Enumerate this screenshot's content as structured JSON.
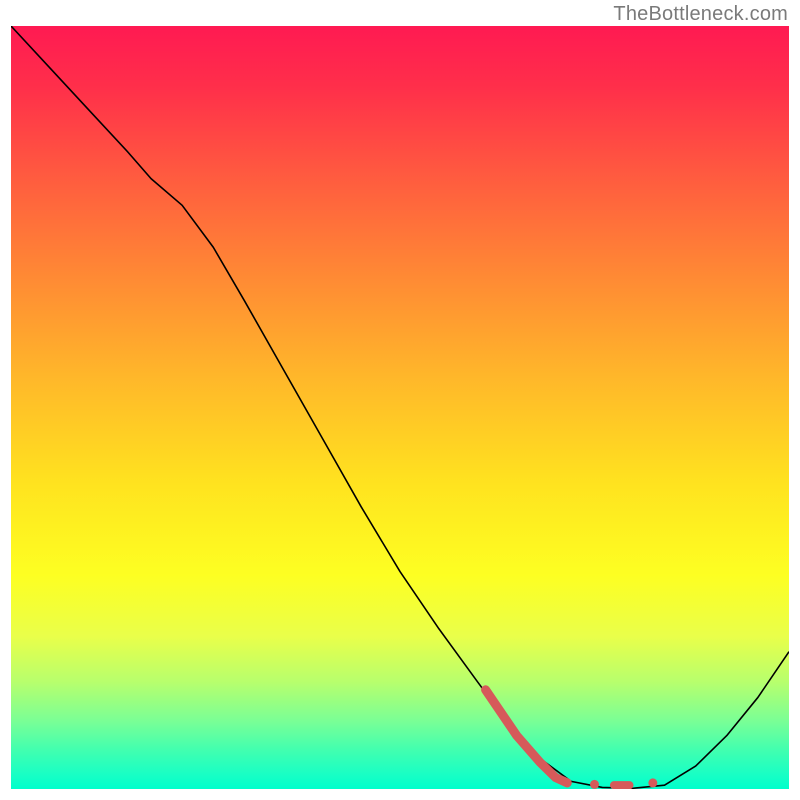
{
  "attribution": "TheBottleneck.com",
  "chart_data": {
    "type": "line",
    "title": "",
    "xlabel": "",
    "ylabel": "",
    "xlim": [
      0,
      100
    ],
    "ylim": [
      0,
      100
    ],
    "background_gradient_stops": [
      {
        "pct": 0,
        "color": "#ff1a52"
      },
      {
        "pct": 8,
        "color": "#ff2f4a"
      },
      {
        "pct": 20,
        "color": "#ff5c3f"
      },
      {
        "pct": 33,
        "color": "#ff8a34"
      },
      {
        "pct": 46,
        "color": "#ffb72a"
      },
      {
        "pct": 60,
        "color": "#ffe31f"
      },
      {
        "pct": 72,
        "color": "#fdff22"
      },
      {
        "pct": 80,
        "color": "#e9ff4a"
      },
      {
        "pct": 86,
        "color": "#b7ff6d"
      },
      {
        "pct": 91,
        "color": "#7bff95"
      },
      {
        "pct": 95,
        "color": "#40ffb0"
      },
      {
        "pct": 98,
        "color": "#1affc4"
      },
      {
        "pct": 100,
        "color": "#00ffcc"
      }
    ],
    "series": [
      {
        "name": "bottleneck-curve",
        "stroke": "#000000",
        "stroke_width": 1.6,
        "points": [
          {
            "x": 0,
            "y": 100
          },
          {
            "x": 5,
            "y": 94.5
          },
          {
            "x": 10,
            "y": 89
          },
          {
            "x": 15,
            "y": 83.5
          },
          {
            "x": 18,
            "y": 80
          },
          {
            "x": 22,
            "y": 76.5
          },
          {
            "x": 26,
            "y": 71
          },
          {
            "x": 30,
            "y": 64
          },
          {
            "x": 35,
            "y": 55
          },
          {
            "x": 40,
            "y": 46
          },
          {
            "x": 45,
            "y": 37
          },
          {
            "x": 50,
            "y": 28.5
          },
          {
            "x": 55,
            "y": 21
          },
          {
            "x": 60,
            "y": 14
          },
          {
            "x": 64,
            "y": 8.5
          },
          {
            "x": 68,
            "y": 4
          },
          {
            "x": 72,
            "y": 1
          },
          {
            "x": 76,
            "y": 0.2
          },
          {
            "x": 80,
            "y": 0.1
          },
          {
            "x": 84,
            "y": 0.5
          },
          {
            "x": 88,
            "y": 3
          },
          {
            "x": 92,
            "y": 7
          },
          {
            "x": 96,
            "y": 12
          },
          {
            "x": 100,
            "y": 18
          }
        ]
      },
      {
        "name": "highlight-segment",
        "stroke": "#d65a5a",
        "stroke_width": 9,
        "linecap": "round",
        "points": [
          {
            "x": 61,
            "y": 13
          },
          {
            "x": 65,
            "y": 7
          },
          {
            "x": 68,
            "y": 3.5
          },
          {
            "x": 70,
            "y": 1.5
          },
          {
            "x": 71.5,
            "y": 0.8
          }
        ]
      },
      {
        "name": "highlight-dot-1",
        "type": "scatter",
        "marker_color": "#d65a5a",
        "marker_radius": 4.5,
        "points": [
          {
            "x": 75,
            "y": 0.6
          }
        ]
      },
      {
        "name": "highlight-dash",
        "stroke": "#d65a5a",
        "stroke_width": 8,
        "linecap": "round",
        "points": [
          {
            "x": 77.5,
            "y": 0.5
          },
          {
            "x": 79.5,
            "y": 0.5
          }
        ]
      },
      {
        "name": "highlight-dot-2",
        "type": "scatter",
        "marker_color": "#d65a5a",
        "marker_radius": 4.5,
        "points": [
          {
            "x": 82.5,
            "y": 0.8
          }
        ]
      }
    ]
  }
}
